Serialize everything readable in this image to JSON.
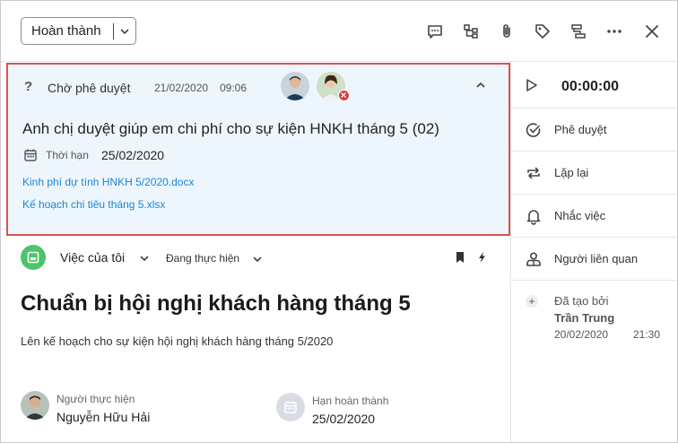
{
  "header": {
    "status_label": "Hoàn thành",
    "tools": [
      "comment-icon",
      "subtask-icon",
      "attachment-icon",
      "tag-icon",
      "workflow-icon",
      "more-icon",
      "close-icon"
    ]
  },
  "approval": {
    "status_icon": "?",
    "status": "Chờ phê duyệt",
    "date": "21/02/2020",
    "time": "09:06",
    "title": "Anh chị duyệt giúp em chi phí cho sự kiện HNKH tháng 5 (02)",
    "deadline_label": "Thời hạn",
    "deadline_value": "25/02/2020",
    "attachments": [
      "Kinh phí dự tính HNKH 5/2020.docx",
      "Kế hoạch chi tiêu tháng 5.xlsx"
    ]
  },
  "task": {
    "category": "Việc của tôi",
    "progress": "Đang thực hiện",
    "title": "Chuẩn bị hội nghị khách hàng tháng 5",
    "description": "Lên kế hoạch cho sự kiện hội nghị khách hàng tháng 5/2020",
    "assignee_label": "Người thực hiện",
    "assignee_name": "Nguyễn Hữu Hải",
    "due_label": "Hạn hoàn thành",
    "due_value": "25/02/2020"
  },
  "right_panel": {
    "timer": "00:00:00",
    "items": [
      {
        "label": "Phê duyệt",
        "icon": "approve-icon"
      },
      {
        "label": "Lặp lại",
        "icon": "repeat-icon"
      },
      {
        "label": "Nhắc việc",
        "icon": "bell-icon"
      },
      {
        "label": "Người liên quan",
        "icon": "people-icon"
      }
    ],
    "created_label": "Đã tạo bởi",
    "created_by": "Trần Trung",
    "created_date": "20/02/2020",
    "created_time": "21:30"
  },
  "colors": {
    "accent_link": "#1a86d0",
    "highlight_border": "#d9534f",
    "card_bg": "#eef6fd",
    "category_green": "#4cc46b",
    "reject_red": "#e03a3a"
  }
}
